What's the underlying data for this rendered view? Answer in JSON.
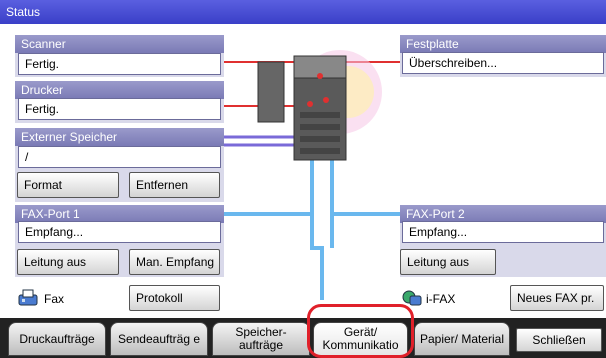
{
  "window": {
    "title": "Status"
  },
  "scanner": {
    "title": "Scanner",
    "status": "Fertig."
  },
  "printer": {
    "title": "Drucker",
    "status": "Fertig."
  },
  "external_storage": {
    "title": "Externer Speicher",
    "value": "/",
    "format_label": "Format",
    "remove_label": "Entfernen"
  },
  "harddisk": {
    "title": "Festplatte",
    "status": "Überschreiben..."
  },
  "fax_port1": {
    "title": "FAX-Port 1",
    "status": "Empfang...",
    "line_off_label": "Leitung aus",
    "manual_receive_label": "Man. Empfang"
  },
  "fax_port2": {
    "title": "FAX-Port 2",
    "status": "Empfang...",
    "line_off_label": "Leitung aus"
  },
  "fax": {
    "label": "Fax",
    "log_label": "Protokoll"
  },
  "ifax": {
    "label": "i-FAX",
    "new_fax_label": "Neues FAX pr."
  },
  "tabs": [
    {
      "label": "Druckaufträge"
    },
    {
      "label": "Sendeaufträg e"
    },
    {
      "label": "Speicher- aufträge"
    },
    {
      "label": "Gerät/ Kommunikatio"
    },
    {
      "label": "Papier/ Material"
    }
  ],
  "close_label": "Schließen",
  "colors": {
    "title_bar": "#3a3fc8",
    "panel_header": "#7a7ab5",
    "line_red": "#e03030",
    "line_blue": "#6ab8ee",
    "highlight": "#e0202a"
  }
}
